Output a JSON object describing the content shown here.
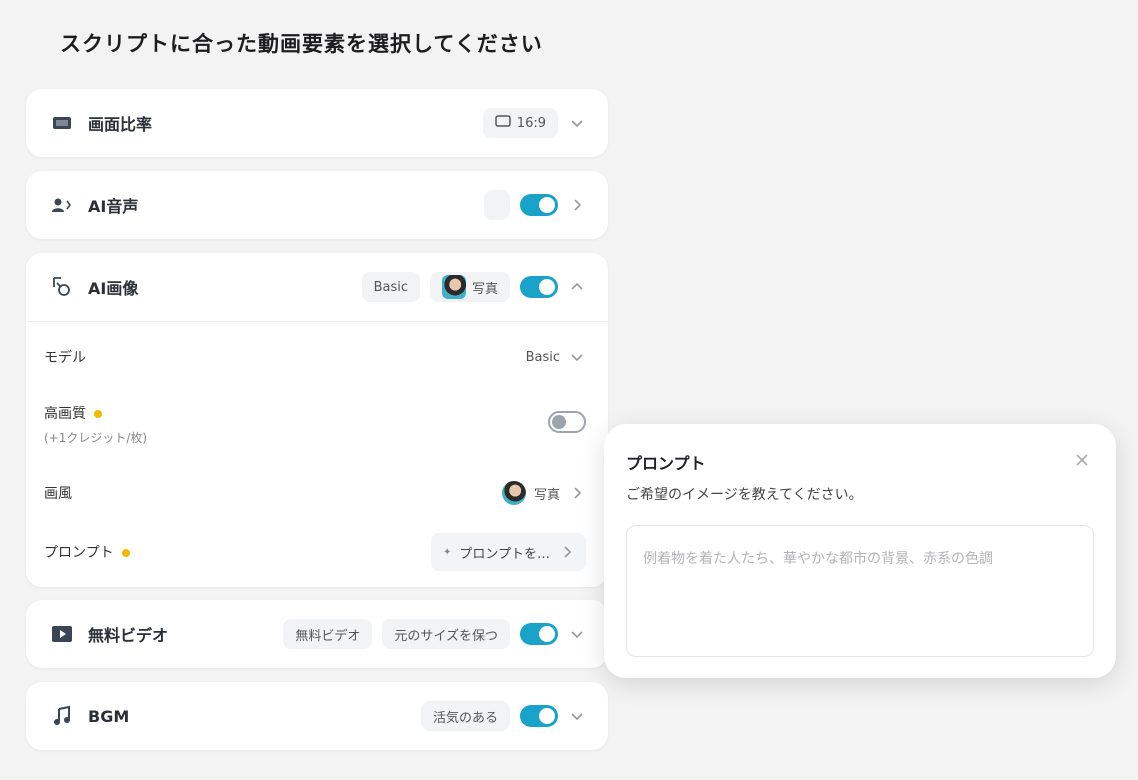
{
  "page_title": "スクリプトに合った動画要素を選択してください",
  "aspect": {
    "title": "画面比率",
    "value": "16:9"
  },
  "voice": {
    "title": "AI音声",
    "enabled": true
  },
  "image": {
    "title": "AI画像",
    "model_chip": "Basic",
    "style_chip": "写真",
    "enabled": true,
    "model": {
      "label": "モデル",
      "value": "Basic"
    },
    "hq": {
      "label": "高画質",
      "hint": "(+1クレジット/枚)",
      "enabled": false
    },
    "style": {
      "label": "画風",
      "value": "写真"
    },
    "prompt": {
      "label": "プロンプト",
      "value": "プロンプトを…"
    }
  },
  "free_video": {
    "title": "無料ビデオ",
    "chip1": "無料ビデオ",
    "chip2": "元のサイズを保つ",
    "enabled": true
  },
  "bgm": {
    "title": "BGM",
    "chip": "活気のある",
    "enabled": true
  },
  "popover": {
    "title": "プロンプト",
    "subtitle": "ご希望のイメージを教えてください。",
    "placeholder": "例着物を着た人たち、華やかな都市の背景、赤系の色調"
  },
  "colors": {
    "accent": "#1aa3c8",
    "premium_dot": "#f5b800"
  },
  "icons": {
    "aspect": "aspect-ratio-icon",
    "voice": "voice-user-icon",
    "image": "ai-image-icon",
    "video": "video-icon",
    "bgm": "music-note-icon",
    "close": "close-icon"
  }
}
